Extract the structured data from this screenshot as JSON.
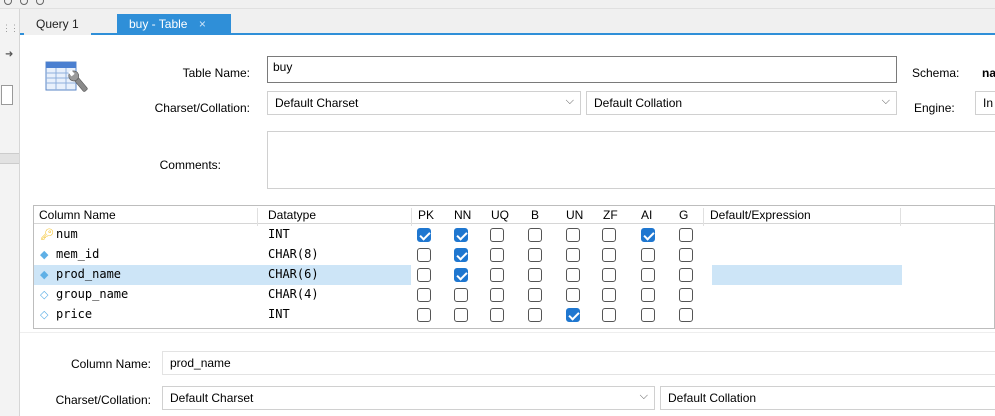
{
  "tabs": [
    {
      "label": "Query 1"
    },
    {
      "label": "buy - Table",
      "close": "×"
    }
  ],
  "form": {
    "table_name_label": "Table Name:",
    "table_name_value": "buy",
    "schema_label": "Schema:",
    "schema_value": "na",
    "charset_label": "Charset/Collation:",
    "charset_value": "Default Charset",
    "collation_value": "Default Collation",
    "engine_label": "Engine:",
    "engine_value": "In",
    "comments_label": "Comments:"
  },
  "grid": {
    "headers": {
      "column_name": "Column Name",
      "datatype": "Datatype",
      "pk": "PK",
      "nn": "NN",
      "uq": "UQ",
      "b": "B",
      "un": "UN",
      "zf": "ZF",
      "ai": "AI",
      "g": "G",
      "default": "Default/Expression"
    },
    "rows": [
      {
        "name": "num",
        "type": "INT",
        "icon": "key-icon",
        "flags": [
          true,
          true,
          false,
          false,
          false,
          false,
          true,
          false
        ]
      },
      {
        "name": "mem_id",
        "type": "CHAR(8)",
        "icon": "diamond-icon",
        "flags": [
          false,
          true,
          false,
          false,
          false,
          false,
          false,
          false
        ]
      },
      {
        "name": "prod_name",
        "type": "CHAR(6)",
        "icon": "diamond-icon",
        "flags": [
          false,
          true,
          false,
          false,
          false,
          false,
          false,
          false
        ],
        "selected": true
      },
      {
        "name": "group_name",
        "type": "CHAR(4)",
        "icon": "diamond-outline-icon",
        "flags": [
          false,
          false,
          false,
          false,
          false,
          false,
          false,
          false
        ]
      },
      {
        "name": "price",
        "type": "INT",
        "icon": "diamond-outline-icon",
        "flags": [
          false,
          false,
          false,
          false,
          true,
          false,
          false,
          false
        ]
      }
    ]
  },
  "detail": {
    "column_name_label": "Column Name:",
    "column_name_value": "prod_name",
    "charset_label": "Charset/Collation:",
    "charset_value": "Default Charset",
    "collation_value": "Default Collation"
  },
  "colors": {
    "accent": "#2f8fd8",
    "checkbox_on": "#1f77d0",
    "selection": "#cde5f7",
    "key_icon": "#f2b705",
    "diamond_icon": "#5fb0e6"
  }
}
